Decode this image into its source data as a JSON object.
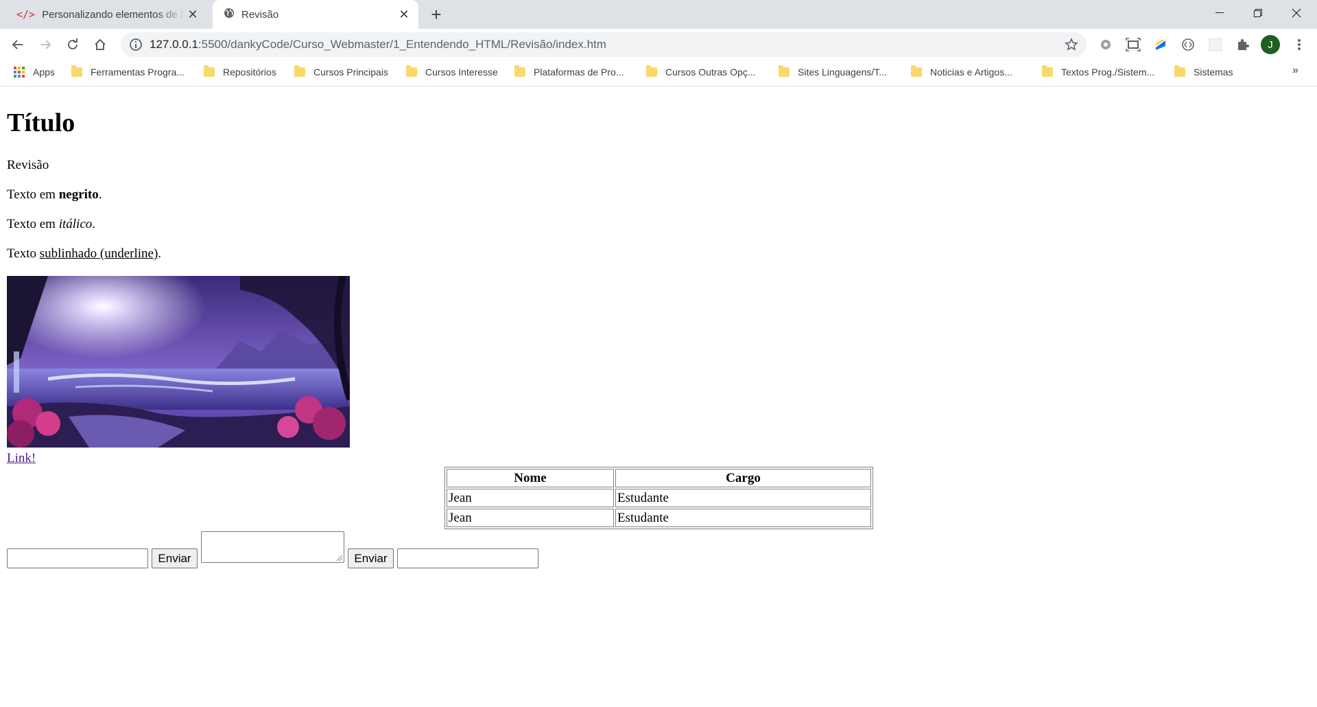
{
  "browser": {
    "tabs": [
      {
        "title": "Personalizando elementos de formulário",
        "icon": "code-icon",
        "active": false
      },
      {
        "title": "Revisão",
        "icon": "globe-icon",
        "active": true
      }
    ],
    "url_host": "127.0.0.1",
    "url_path": ":5500/dankyCode/Curso_Webmaster/1_Entendendo_HTML/Revisão/index.htm",
    "profile_initial": "J",
    "bookmarks": [
      {
        "label": "Apps",
        "icon": "apps-grid-icon"
      },
      {
        "label": "Ferramentas Progra...",
        "icon": "folder-icon"
      },
      {
        "label": "Repositórios",
        "icon": "folder-icon"
      },
      {
        "label": "Cursos Principais",
        "icon": "folder-icon"
      },
      {
        "label": "Cursos Interesse",
        "icon": "folder-icon"
      },
      {
        "label": "Plataformas de Pro...",
        "icon": "folder-icon"
      },
      {
        "label": "Cursos Outras Opç...",
        "icon": "folder-icon"
      },
      {
        "label": "Sites Linguagens/T...",
        "icon": "folder-icon"
      },
      {
        "label": "Noticias e Artigos...",
        "icon": "folder-icon"
      },
      {
        "label": "Textos Prog./Sistem...",
        "icon": "folder-icon"
      },
      {
        "label": "Sistemas",
        "icon": "folder-icon"
      }
    ],
    "more_bookmarks": "»"
  },
  "page": {
    "heading": "Título",
    "line1": "Revisão",
    "bold_prefix": "Texto em ",
    "bold_word": "negrito",
    "italic_prefix": "Texto em ",
    "italic_word": "itálico",
    "underline_prefix": "Texto ",
    "underline_word": "sublinhado (underline)",
    "period": ".",
    "link": "Link!",
    "table": {
      "headers": [
        "Nome",
        "Cargo"
      ],
      "rows": [
        [
          "Jean",
          "Estudante"
        ],
        [
          "Jean",
          "Estudante"
        ]
      ]
    },
    "button1": "Enviar",
    "button2": "Enviar"
  },
  "colors": {
    "link_visited": "#551a8b",
    "tabstrip": "#dee1e6",
    "avatar": "#1e5e20"
  }
}
